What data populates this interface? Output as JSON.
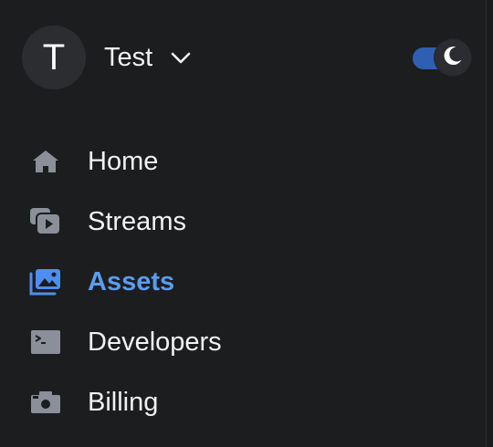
{
  "account": {
    "avatar_initial": "T",
    "name": "Test",
    "chevron_icon": "chevron-down-icon"
  },
  "theme_toggle": {
    "state": "dark",
    "on": true,
    "icon": "moon-icon",
    "track_color": "#2f5fb2"
  },
  "nav": {
    "items": [
      {
        "label": "Home",
        "icon": "home-icon",
        "active": false
      },
      {
        "label": "Streams",
        "icon": "streams-icon",
        "active": false
      },
      {
        "label": "Assets",
        "icon": "assets-icon",
        "active": true
      },
      {
        "label": "Developers",
        "icon": "terminal-icon",
        "active": false
      },
      {
        "label": "Billing",
        "icon": "billing-icon",
        "active": false
      }
    ]
  },
  "colors": {
    "background": "#1c1d1f",
    "accent": "#5a9cf0",
    "icon_muted": "#8a8f99",
    "text": "#f2f2f2"
  }
}
